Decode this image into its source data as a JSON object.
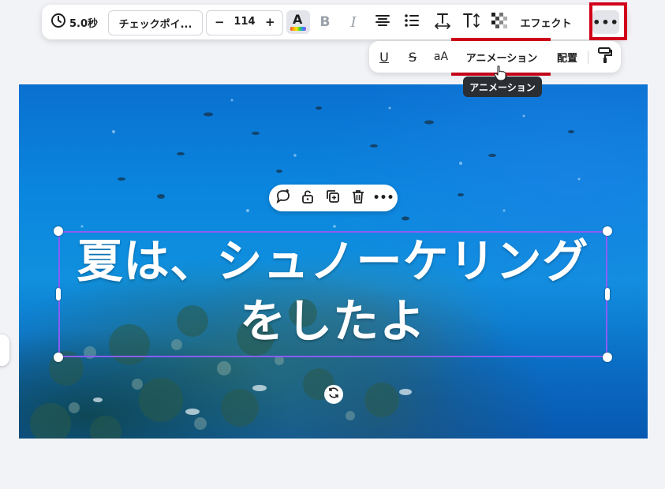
{
  "toolbar": {
    "duration": "5.0秒",
    "font_name": "チェックポイ...",
    "font_size": "114",
    "minus": "−",
    "plus": "+",
    "text_color_letter": "A",
    "bold_letter": "B",
    "italic_letter": "I",
    "effect_label": "エフェクト",
    "more_label": "•••"
  },
  "sub_toolbar": {
    "underline_letter": "U",
    "strike_letter": "S",
    "case_label": "aA",
    "animation_label": "アニメーション",
    "layout_label": "配置"
  },
  "tooltip": {
    "text": "アニメーション"
  },
  "canvas": {
    "headline_line1": "夏は、シュノーケリング",
    "headline_line2": "をしたよ"
  },
  "context_menu": {
    "more_label": "•••"
  },
  "colors": {
    "highlight": "#d2001a",
    "selection": "#8b5cf6",
    "tooltip_bg": "#2b2e33"
  },
  "icons": [
    "clock-icon",
    "text-color-icon",
    "align-icon",
    "list-icon",
    "letter-spacing-icon",
    "text-orientation-icon",
    "transparency-icon",
    "more-icon",
    "paint-roller-icon",
    "hand-cursor-icon",
    "comment-icon",
    "lock-icon",
    "duplicate-icon",
    "trash-icon",
    "rotate-icon"
  ]
}
